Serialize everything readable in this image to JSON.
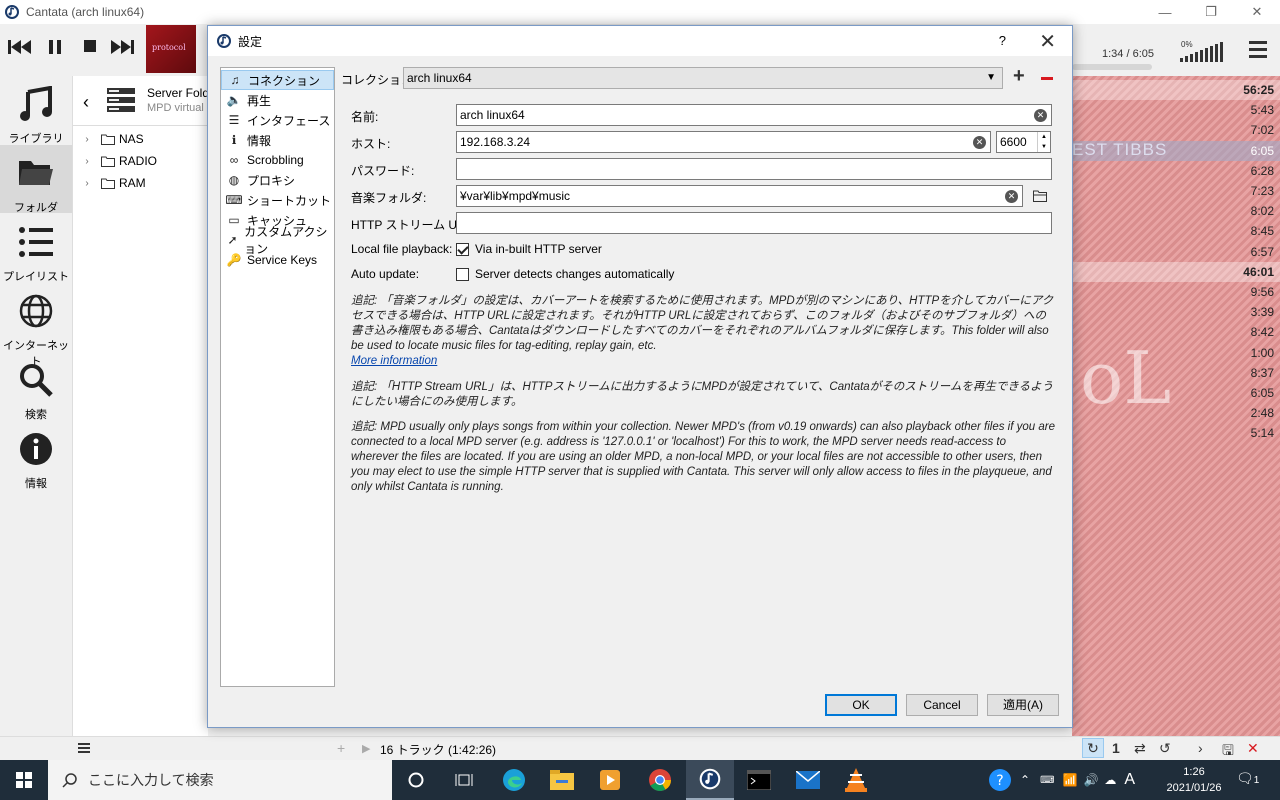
{
  "window": {
    "title": "Cantata (arch linux64)",
    "controls": [
      "—",
      "❐",
      "✕"
    ]
  },
  "player": {
    "cover_text": "protocol",
    "time": "1:34 / 6:05",
    "volume_percent": "0%"
  },
  "sidebar": {
    "items": [
      {
        "label": "ライブラリ",
        "icon": "music-note-icon"
      },
      {
        "label": "フォルダ",
        "icon": "folder-icon"
      },
      {
        "label": "プレイリスト",
        "icon": "playlist-icon"
      },
      {
        "label": "インターネット",
        "icon": "globe-icon"
      },
      {
        "label": "検索",
        "icon": "search-icon"
      },
      {
        "label": "情報",
        "icon": "info-icon"
      }
    ]
  },
  "browser": {
    "title": "Server Folde",
    "subtitle": "MPD virtual",
    "folders": [
      "NAS",
      "RADIO",
      "RAM"
    ]
  },
  "playlist": {
    "rows": [
      {
        "text": "56:25",
        "style": "bold"
      },
      {
        "text": "5:43",
        "style": ""
      },
      {
        "text": "7:02",
        "style": ""
      },
      {
        "text": "6:05",
        "style": "hl"
      },
      {
        "text": "6:28",
        "style": ""
      },
      {
        "text": "7:23",
        "style": ""
      },
      {
        "text": "8:02",
        "style": ""
      },
      {
        "text": "8:45",
        "style": ""
      },
      {
        "text": "6:57",
        "style": ""
      },
      {
        "text": "46:01",
        "style": "bold"
      },
      {
        "text": "9:56",
        "style": ""
      },
      {
        "text": "3:39",
        "style": ""
      },
      {
        "text": "8:42",
        "style": ""
      },
      {
        "text": "1:00",
        "style": ""
      },
      {
        "text": "8:37",
        "style": ""
      },
      {
        "text": "6:05",
        "style": ""
      },
      {
        "text": "2:48",
        "style": ""
      },
      {
        "text": "5:14",
        "style": ""
      }
    ],
    "highlight_text": "EST TIBBS",
    "watermark": "oL"
  },
  "bottom_bar": {
    "track_info": "16 トラック (1:42:26)",
    "repeat_count": "1"
  },
  "dialog": {
    "title": "設定",
    "help": "?",
    "nav": [
      {
        "label": "コネクション",
        "icon": "♫",
        "selected": true
      },
      {
        "label": "再生",
        "icon": "🔈"
      },
      {
        "label": "インタフェース",
        "icon": "☰"
      },
      {
        "label": "情報",
        "icon": "ℹ"
      },
      {
        "label": "Scrobbling",
        "icon": "∞"
      },
      {
        "label": "プロキシ",
        "icon": "◍"
      },
      {
        "label": "ショートカット",
        "icon": "⌨"
      },
      {
        "label": "キャッシュ",
        "icon": "▭"
      },
      {
        "label": "カスタムアクション",
        "icon": "➚"
      },
      {
        "label": "Service Keys",
        "icon": "🔑"
      }
    ],
    "collection_label": "コレクション:",
    "collection_value": "arch linux64",
    "name_label": "名前:",
    "name_value": "arch linux64",
    "host_label": "ホスト:",
    "host_value": "192.168.3.24",
    "port_value": "6600",
    "password_label": "パスワード:",
    "password_value": "",
    "music_folder_label": "音楽フォルダ:",
    "music_folder_value": "¥var¥lib¥mpd¥music",
    "http_url_label": "HTTP ストリーム URL:",
    "http_url_value": "",
    "local_playback_label": "Local file playback:",
    "local_playback_option": "Via in-built HTTP server",
    "local_playback_checked": true,
    "auto_update_label": "Auto update:",
    "auto_update_option": "Server detects changes automatically",
    "auto_update_checked": false,
    "note1": "追記: 「音楽フォルダ」の設定は、カバーアートを検索するために使用されます。MPDが別のマシンにあり、HTTPを介してカバーにアクセスできる場合は、HTTP URLに設定されます。それがHTTP URLに設定されておらず、このフォルダ（およびそのサブフォルダ）への書き込み権限もある場合、Cantataはダウンロードしたすべてのカバーをそれぞれのアルバムフォルダに保存します。This folder will also be used to locate music files for tag-editing, replay gain, etc.",
    "note1_link": "More information",
    "note2": "追記: 「HTTP Stream URL」は、HTTPストリームに出力するようにMPDが設定されていて、Cantataがそのストリームを再生できるようにしたい場合にのみ使用します。",
    "note3": "追記: MPD usually only plays songs from within your collection. Newer MPD's (from v0.19 onwards) can also playback other files if you are connected to a local MPD server (e.g. address is '127.0.0.1' or 'localhost') For this to work, the MPD server needs read-access to wherever the files are located. If you are using an older MPD, a non-local MPD, or your local files are not accessible to other users, then you may elect to use the simple HTTP server that is supplied with Cantata. This server will only allow access to files in the playqueue, and only whilst Cantata is running.",
    "buttons": {
      "ok": "OK",
      "cancel": "Cancel",
      "apply": "適用(A)"
    }
  },
  "taskbar": {
    "search_placeholder": "ここに入力して検索",
    "time": "1:26",
    "date": "2021/01/26",
    "ime": "A",
    "notification_count": "1"
  }
}
